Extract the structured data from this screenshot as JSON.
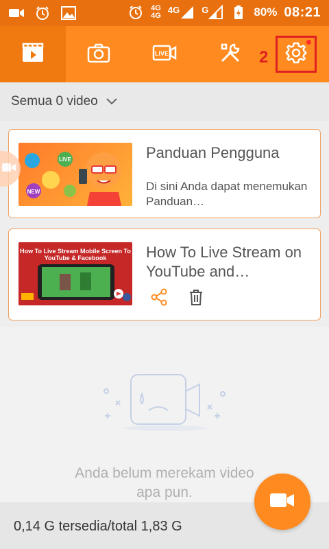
{
  "status_bar": {
    "network_label": "4G",
    "network_small_top": "4G",
    "network_small_bottom": "4G",
    "carrier2_label": "G",
    "battery_percent": "80%",
    "time": "08:21"
  },
  "toolbar": {
    "tabs": [
      {
        "name": "videos",
        "icon": "video-library-icon"
      },
      {
        "name": "screenshots",
        "icon": "camera-icon"
      },
      {
        "name": "live",
        "icon": "live-video-icon",
        "text": "LIVE"
      },
      {
        "name": "tools",
        "icon": "tools-icon"
      },
      {
        "name": "settings",
        "icon": "gear-icon"
      }
    ],
    "annotation_number": "2"
  },
  "filter": {
    "label": "Semua 0 video"
  },
  "cards": [
    {
      "title": "Panduan Pengguna",
      "description": "Di sini Anda dapat menemukan Panduan…",
      "thumb_badges": [
        "LIVE",
        "NEW"
      ]
    },
    {
      "title": "How To Live Stream on YouTube and…",
      "thumb_caption": "How To Live Stream Mobile Screen To YouTube & Facebook"
    }
  ],
  "empty_state": {
    "line1": "Anda belum merekam video",
    "line2": "apa pun."
  },
  "storage": {
    "text": "0,14 G tersedia/total 1,83 G"
  },
  "colors": {
    "accent": "#ff8a1f",
    "status_bar": "#e9700e",
    "annotation_red": "#e02020"
  }
}
